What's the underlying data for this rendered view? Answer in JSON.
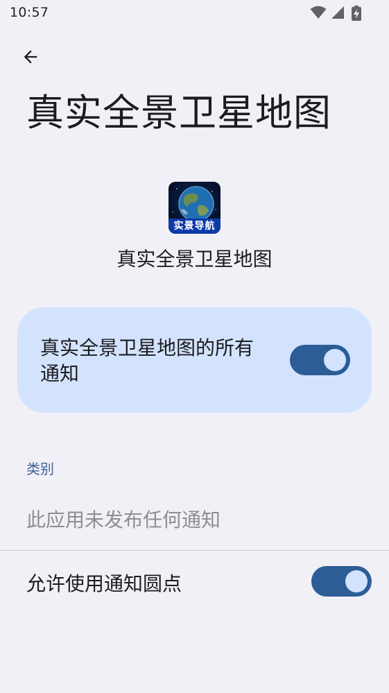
{
  "status_bar": {
    "time": "10:57",
    "icons": [
      "wifi-icon",
      "cellular-signal-icon",
      "battery-charging-icon"
    ]
  },
  "header": {
    "back_icon": "arrow-left-icon",
    "title": "真实全景卫星地图"
  },
  "app": {
    "icon_caption": "实景导航",
    "name": "真实全景卫星地图"
  },
  "all_notifications": {
    "label": "真实全景卫星地图的所有通知",
    "enabled": true
  },
  "categories": {
    "header": "类别",
    "empty_text": "此应用未发布任何通知"
  },
  "notification_dot": {
    "label": "允许使用通知圆点",
    "enabled": true
  },
  "colors": {
    "background": "#f1f0f6",
    "card": "#d3e3fd",
    "switch_track": "#2d5d96",
    "accent_text": "#3d6398"
  }
}
